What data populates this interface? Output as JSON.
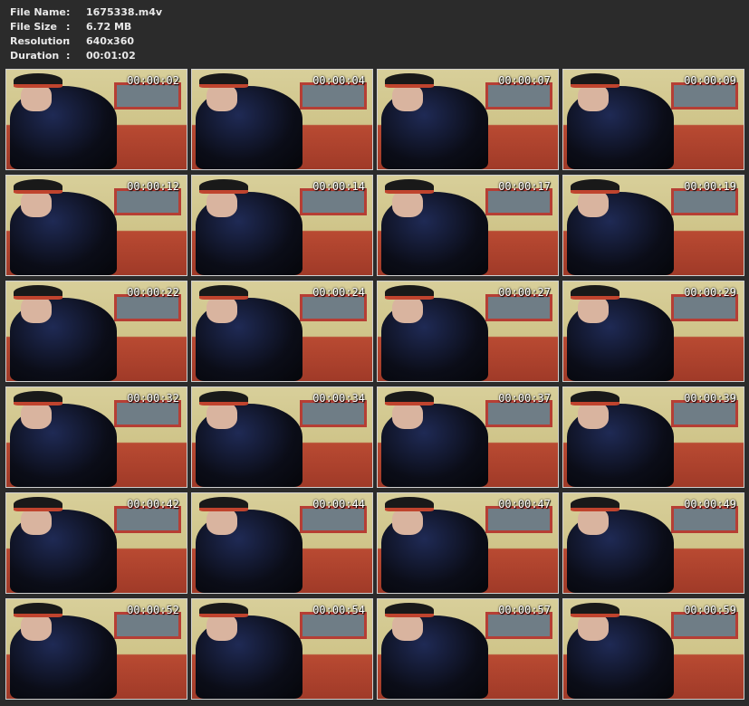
{
  "meta": {
    "file_name_label": "File Name",
    "file_name_value": "1675338.m4v",
    "file_size_label": "File Size",
    "file_size_value": "6.72 MB",
    "resolution_label": "Resolution",
    "resolution_value": "640x360",
    "duration_label": "Duration",
    "duration_value": "00:01:02",
    "separator": ":"
  },
  "thumbnails": [
    {
      "timestamp": "00:00:02"
    },
    {
      "timestamp": "00:00:04"
    },
    {
      "timestamp": "00:00:07"
    },
    {
      "timestamp": "00:00:09"
    },
    {
      "timestamp": "00:00:12"
    },
    {
      "timestamp": "00:00:14"
    },
    {
      "timestamp": "00:00:17"
    },
    {
      "timestamp": "00:00:19"
    },
    {
      "timestamp": "00:00:22"
    },
    {
      "timestamp": "00:00:24"
    },
    {
      "timestamp": "00:00:27"
    },
    {
      "timestamp": "00:00:29"
    },
    {
      "timestamp": "00:00:32"
    },
    {
      "timestamp": "00:00:34"
    },
    {
      "timestamp": "00:00:37"
    },
    {
      "timestamp": "00:00:39"
    },
    {
      "timestamp": "00:00:42"
    },
    {
      "timestamp": "00:00:44"
    },
    {
      "timestamp": "00:00:47"
    },
    {
      "timestamp": "00:00:49"
    },
    {
      "timestamp": "00:00:52"
    },
    {
      "timestamp": "00:00:54"
    },
    {
      "timestamp": "00:00:57"
    },
    {
      "timestamp": "00:00:59"
    }
  ],
  "colors": {
    "background": "#2b2b2b",
    "text": "#e8e8e8",
    "thumb_border": "#cfcfcf"
  }
}
